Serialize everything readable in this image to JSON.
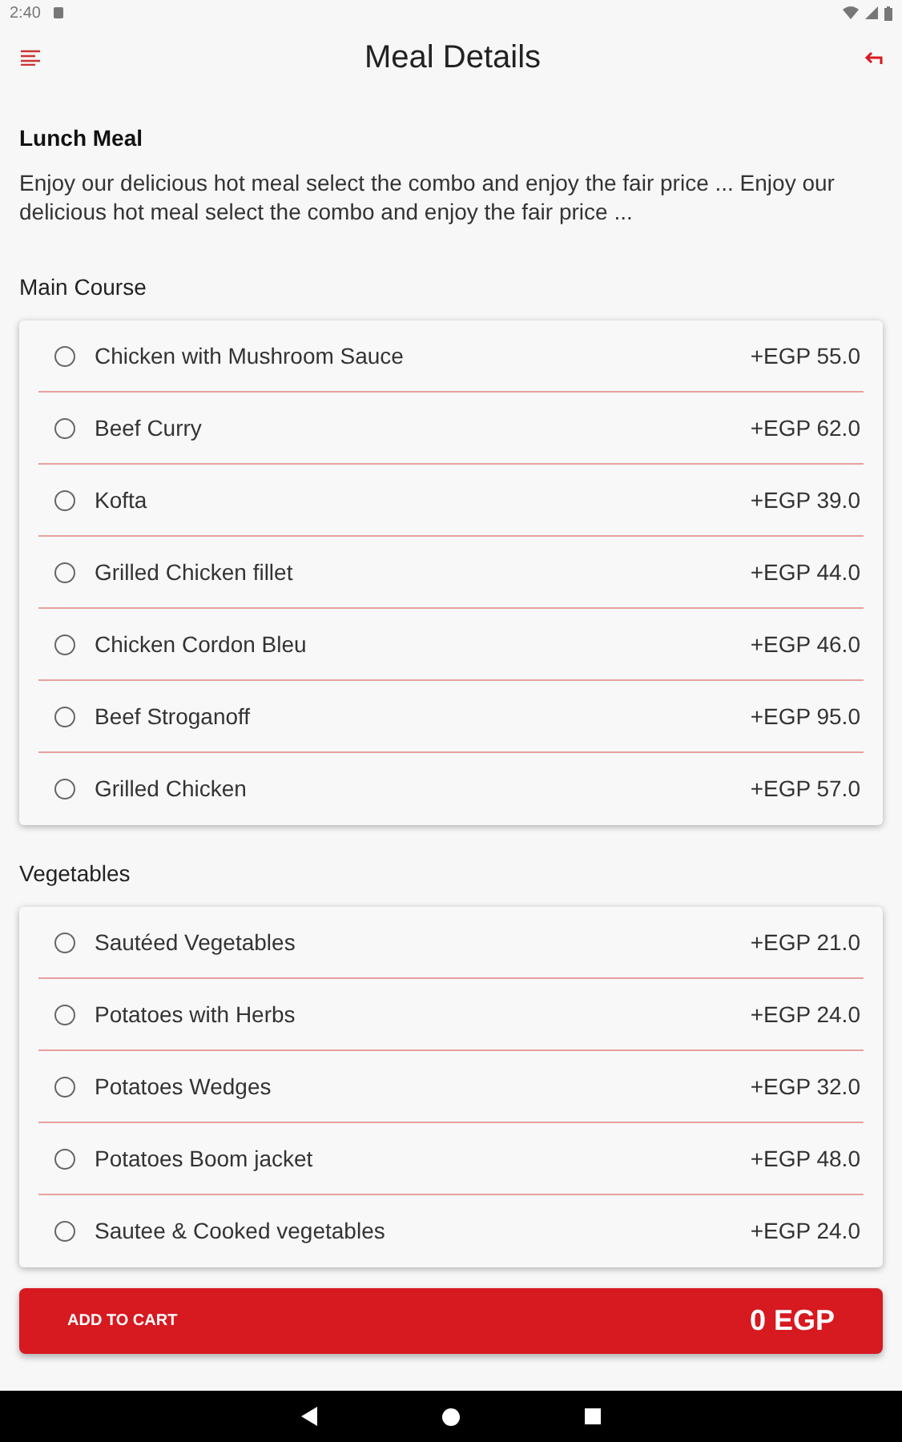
{
  "status_bar": {
    "time": "2:40"
  },
  "app_bar": {
    "title": "Meal Details"
  },
  "meal": {
    "name": "Lunch Meal",
    "description": "Enjoy our delicious hot meal select the combo and enjoy the fair price ... Enjoy our delicious hot meal select the combo and enjoy the fair price ..."
  },
  "sections": [
    {
      "title": "Main Course",
      "options": [
        {
          "name": "Chicken with Mushroom Sauce",
          "price": "+EGP 55.0",
          "selected": false
        },
        {
          "name": "Beef Curry",
          "price": "+EGP 62.0",
          "selected": false
        },
        {
          "name": "Kofta",
          "price": "+EGP 39.0",
          "selected": false
        },
        {
          "name": "Grilled Chicken fillet",
          "price": "+EGP 44.0",
          "selected": false
        },
        {
          "name": "Chicken Cordon Bleu",
          "price": "+EGP 46.0",
          "selected": false
        },
        {
          "name": "Beef Stroganoff",
          "price": "+EGP 95.0",
          "selected": false
        },
        {
          "name": "Grilled Chicken",
          "price": "+EGP 57.0",
          "selected": false
        }
      ]
    },
    {
      "title": "Vegetables",
      "options": [
        {
          "name": "Sautéed Vegetables",
          "price": "+EGP 21.0",
          "selected": false
        },
        {
          "name": "Potatoes with Herbs",
          "price": "+EGP 24.0",
          "selected": false
        },
        {
          "name": "Potatoes Wedges",
          "price": "+EGP 32.0",
          "selected": false
        },
        {
          "name": "Potatoes Boom jacket",
          "price": "+EGP 48.0",
          "selected": false
        },
        {
          "name": "Sautee & Cooked vegetables",
          "price": "+EGP 24.0",
          "selected": false
        }
      ]
    }
  ],
  "cart_button": {
    "label": "ADD TO CART",
    "total": "0 EGP"
  }
}
